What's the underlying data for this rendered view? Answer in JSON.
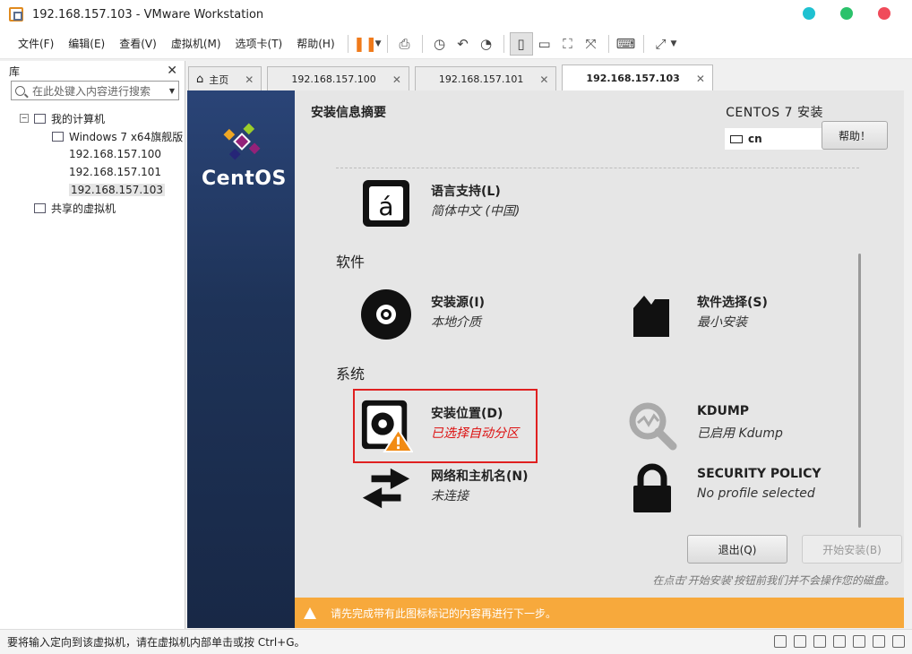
{
  "window": {
    "title": "192.168.157.103 - VMware Workstation",
    "dot_colors": [
      "#1fc1d1",
      "#2bc26b",
      "#f04b5a"
    ]
  },
  "menu": [
    "文件(F)",
    "编辑(E)",
    "查看(V)",
    "虚拟机(M)",
    "选项卡(T)",
    "帮助(H)"
  ],
  "library": {
    "title": "库",
    "search_placeholder": "在此处键入内容进行搜索",
    "tree": {
      "root": "我的计算机",
      "vms": [
        "Windows 7 x64旗舰版",
        "192.168.157.100",
        "192.168.157.101",
        "192.168.157.103"
      ],
      "shared": "共享的虚拟机"
    }
  },
  "tabs": [
    {
      "label": "主页"
    },
    {
      "label": "192.168.157.100"
    },
    {
      "label": "192.168.157.101"
    },
    {
      "label": "192.168.157.103"
    }
  ],
  "installer": {
    "brand": "CentOS",
    "page_title": "安装信息摘要",
    "install_title": "CENTOS 7 安装",
    "keyboard": "cn",
    "help_label": "帮助！",
    "sections": {
      "software": "软件",
      "system": "系统"
    },
    "spokes": {
      "language": {
        "title": "语言支持(L)",
        "status": "简体中文 (中国)"
      },
      "source": {
        "title": "安装源(I)",
        "status": "本地介质"
      },
      "software": {
        "title": "软件选择(S)",
        "status": "最小安装"
      },
      "destination": {
        "title": "安装位置(D)",
        "status": "已选择自动分区"
      },
      "kdump": {
        "title": "KDUMP",
        "status": "已启用 Kdump"
      },
      "network": {
        "title": "网络和主机名(N)",
        "status": "未连接"
      },
      "security": {
        "title": "SECURITY POLICY",
        "status": "No profile selected"
      }
    },
    "quit_label": "退出(Q)",
    "begin_label": "开始安装(B)",
    "hint": "在点击'开始安装'按钮前我们并不会操作您的磁盘。",
    "warning": "请先完成带有此图标标记的内容再进行下一步。"
  },
  "statusbar": {
    "text": "要将输入定向到该虚拟机，请在虚拟机内部单击或按 Ctrl+G。"
  }
}
